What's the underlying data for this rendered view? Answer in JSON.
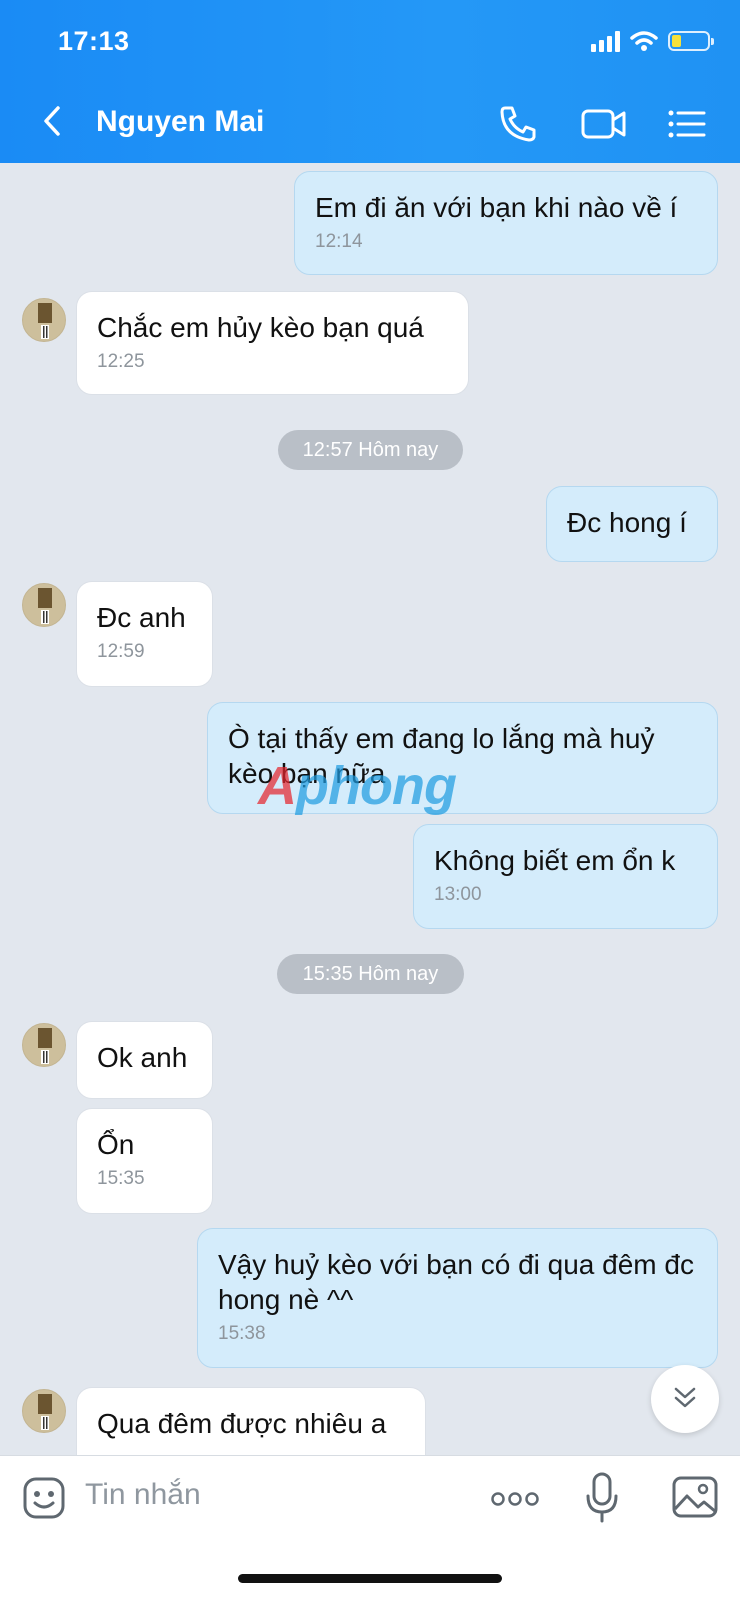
{
  "status_bar": {
    "time": "17:13"
  },
  "header": {
    "contact_name": "Nguyen Mai"
  },
  "messages": [
    {
      "text": "Em đi ăn với bạn khi nào về í",
      "time": "12:14"
    },
    {
      "text": "Chắc em hủy kèo bạn quá",
      "time": "12:25"
    },
    {
      "text": "Đc hong í"
    },
    {
      "text": "Đc anh",
      "time": "12:59"
    },
    {
      "text": "Ò tại thấy em đang lo lắng mà huỷ kèo bạn nữa"
    },
    {
      "text": "Không biết em ổn k",
      "time": "13:00"
    },
    {
      "text": "Ok anh"
    },
    {
      "text": "Ổn",
      "time": "15:35"
    },
    {
      "text": "Vậy huỷ kèo với bạn có đi qua đêm đc hong nè ^^",
      "time": "15:38"
    },
    {
      "text": "Qua đêm được nhiêu a"
    }
  ],
  "date_separators": [
    "12:57 Hôm nay",
    "15:35 Hôm nay"
  ],
  "watermark": {
    "part1": "A",
    "part2": "phong"
  },
  "composer": {
    "placeholder": "Tin nhắn"
  },
  "icons": [
    "back-icon",
    "phone-icon",
    "video-call-icon",
    "menu-list-icon",
    "sticker-icon",
    "more-icon",
    "microphone-icon",
    "image-icon",
    "scroll-down-icon"
  ],
  "colors": {
    "header_blue": "#1a8bf5",
    "outgoing_bubble": "#d4ecfb",
    "incoming_bubble": "#ffffff",
    "chat_background": "#e2e7ee"
  }
}
